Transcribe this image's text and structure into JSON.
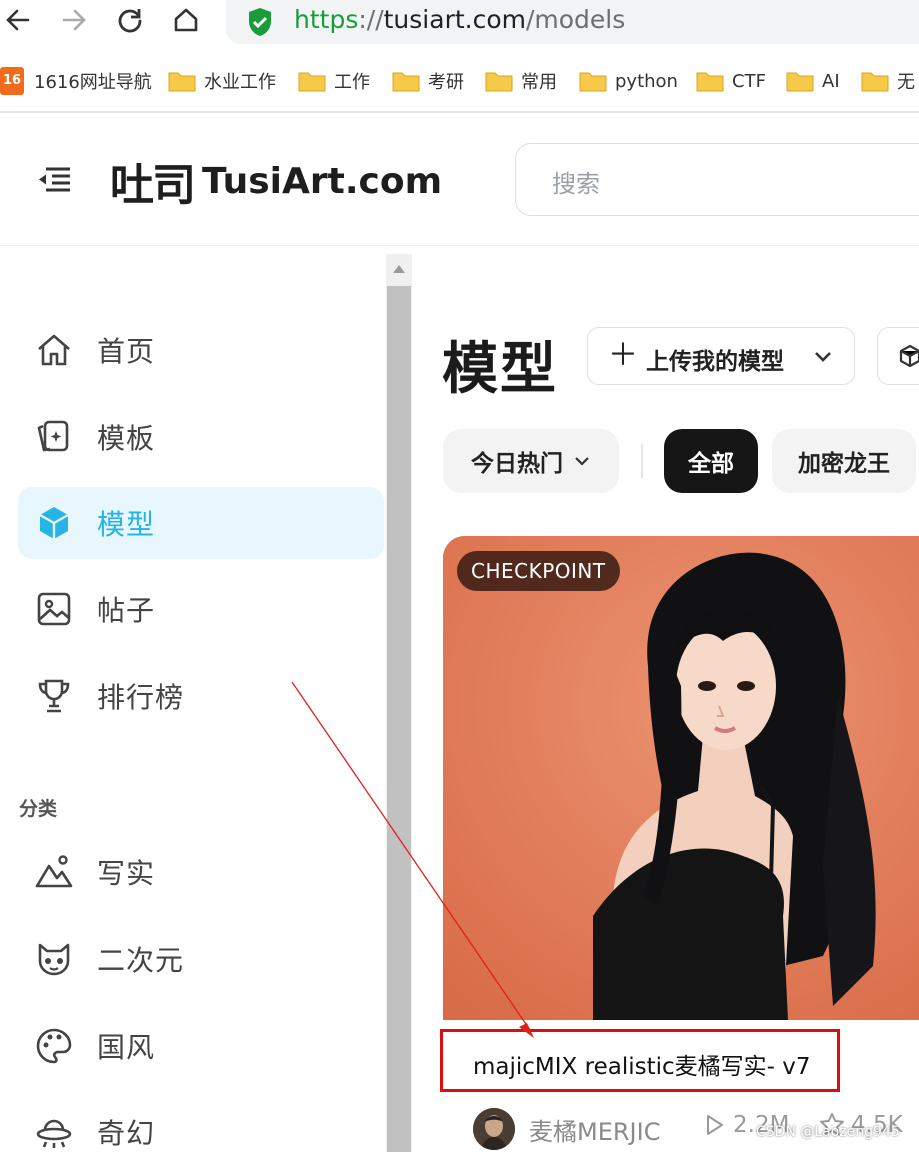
{
  "browser": {
    "url_scheme": "https",
    "url_sep": "://",
    "url_host": "tusiart.com",
    "url_path": "/models",
    "back_icon": "arrow-left-icon",
    "forward_icon": "arrow-right-icon",
    "reload_icon": "reload-icon",
    "home_icon": "home-icon",
    "security_icon": "shield-check-icon"
  },
  "bookmarks": [
    {
      "label": "1616网址导航",
      "icon": "1616-logo-icon"
    },
    {
      "label": "水业工作",
      "icon": "folder-icon"
    },
    {
      "label": "工作",
      "icon": "folder-icon"
    },
    {
      "label": "考研",
      "icon": "folder-icon"
    },
    {
      "label": "常用",
      "icon": "folder-icon"
    },
    {
      "label": "python",
      "icon": "folder-icon"
    },
    {
      "label": "CTF",
      "icon": "folder-icon"
    },
    {
      "label": "AI",
      "icon": "folder-icon"
    },
    {
      "label": "无",
      "icon": "folder-icon"
    }
  ],
  "header": {
    "logo_mark": "吐司",
    "logo_text": "TusiArt.com",
    "search_placeholder": "搜索"
  },
  "sidebar": {
    "items": [
      {
        "label": "首页",
        "icon": "home-icon"
      },
      {
        "label": "模板",
        "icon": "template-cards-icon"
      },
      {
        "label": "模型",
        "icon": "cube-icon"
      },
      {
        "label": "帖子",
        "icon": "image-icon"
      },
      {
        "label": "排行榜",
        "icon": "trophy-icon"
      }
    ],
    "section_title": "分类",
    "categories": [
      {
        "label": "写实",
        "icon": "mountain-icon"
      },
      {
        "label": "二次元",
        "icon": "anime-face-icon"
      },
      {
        "label": "国风",
        "icon": "palette-icon"
      },
      {
        "label": "奇幻",
        "icon": "ufo-icon"
      }
    ]
  },
  "main": {
    "title": "模型",
    "upload_label": "上传我的模型",
    "filters": {
      "sort_label": "今日热门",
      "tabs": [
        "全部",
        "加密龙王"
      ]
    },
    "card": {
      "badge": "CHECKPOINT",
      "title": "majicMIX realistic麦橘写实- v7",
      "author": "麦橘MERJIC",
      "views": "2.2M",
      "likes": "4.5K"
    }
  },
  "watermark": "CSDN @Laozeng945",
  "colors": {
    "accent": "#24b5e6",
    "active_bg": "#e8f7fd",
    "annotation_red": "#d90f0f",
    "url_green": "#1a9c3a",
    "card_bg": "#e07a55"
  }
}
